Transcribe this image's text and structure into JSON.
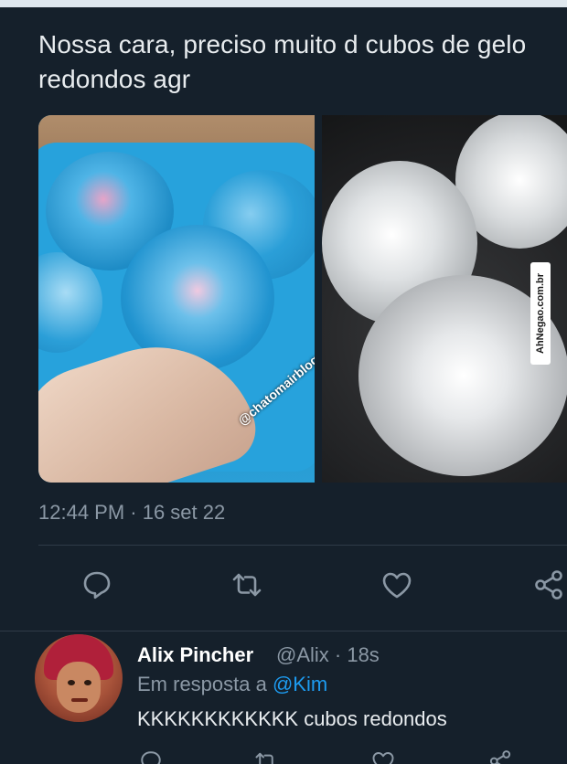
{
  "tweet": {
    "text": "Nossa cara, preciso muito d cubos de gelo redondos agr",
    "timestamp": "12:44 PM · 16 set 22",
    "media_watermark": "@chatomairblog"
  },
  "actions": {
    "reply_icon": "reply-icon",
    "retweet_icon": "retweet-icon",
    "like_icon": "heart-icon",
    "share_icon": "share-icon"
  },
  "side_watermark": "AhNegao.com.br",
  "reply": {
    "name": "Alix Pincher",
    "handle_time": "@Alix · 18s",
    "replying_prefix": "Em resposta a ",
    "replying_mention": "@Kim",
    "text": "KKKKKKKKKKKK cubos redondos"
  },
  "colors": {
    "background": "#15202b",
    "secondary_text": "#8b98a5",
    "link": "#1d9bf0",
    "divider": "#2f3b47"
  }
}
